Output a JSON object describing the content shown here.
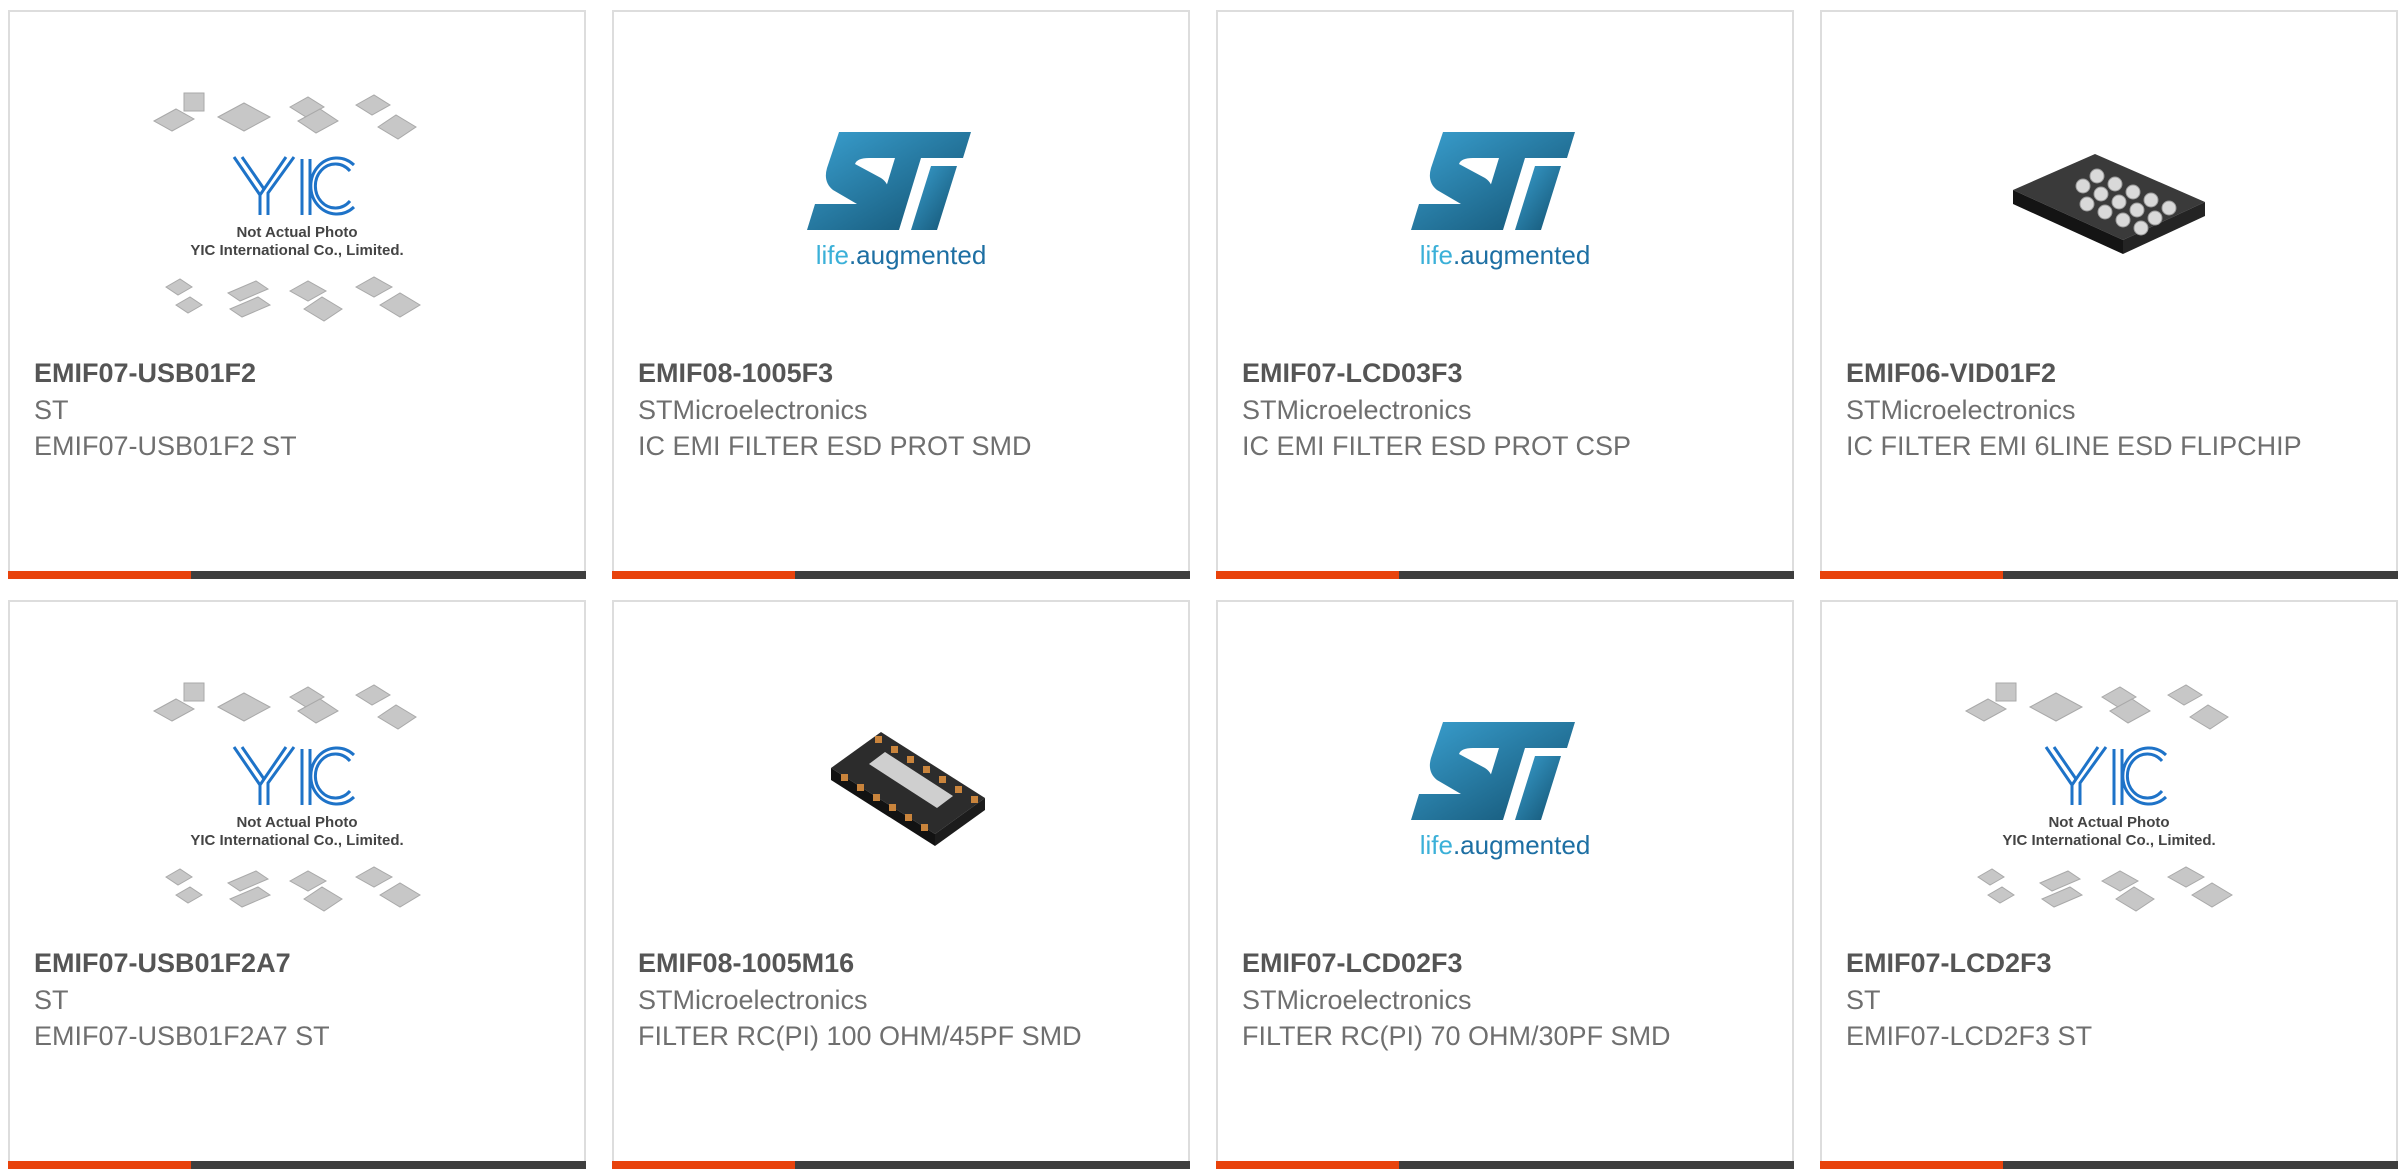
{
  "colors": {
    "accent": "#e8430c",
    "bar": "#3e3e3e",
    "st_blue": "#1d6fa3",
    "st_light": "#3bb0d8",
    "yic_blue": "#1e73c8"
  },
  "products": [
    {
      "part": "EMIF07-USB01F2",
      "maker": "ST",
      "desc": "EMIF07-USB01F2 ST",
      "image": "yic-placeholder-image",
      "caption1": "Not Actual Photo",
      "caption2": "YIC International Co., Limited."
    },
    {
      "part": "EMIF08-1005F3",
      "maker": "STMicroelectronics",
      "desc": "IC EMI FILTER ESD PROT SMD",
      "image": "st-logo-image",
      "tagline1": "life",
      "tagline2": ".augmented"
    },
    {
      "part": "EMIF07-LCD03F3",
      "maker": "STMicroelectronics",
      "desc": "IC EMI FILTER ESD PROT CSP",
      "image": "st-logo-image",
      "tagline1": "life",
      "tagline2": ".augmented"
    },
    {
      "part": "EMIF06-VID01F2",
      "maker": "STMicroelectronics",
      "desc": "IC FILTER EMI 6LINE ESD FLIPCHIP",
      "image": "bga-chip-image"
    },
    {
      "part": "EMIF07-USB01F2A7",
      "maker": "ST",
      "desc": "EMIF07-USB01F2A7 ST",
      "image": "yic-placeholder-image",
      "caption1": "Not Actual Photo",
      "caption2": "YIC International Co., Limited."
    },
    {
      "part": "EMIF08-1005M16",
      "maker": "STMicroelectronics",
      "desc": "FILTER RC(PI) 100 OHM/45PF SMD",
      "image": "qfn-chip-image"
    },
    {
      "part": "EMIF07-LCD02F3",
      "maker": "STMicroelectronics",
      "desc": "FILTER RC(PI) 70 OHM/30PF SMD",
      "image": "st-logo-image",
      "tagline1": "life",
      "tagline2": ".augmented"
    },
    {
      "part": "EMIF07-LCD2F3",
      "maker": "ST",
      "desc": "EMIF07-LCD2F3 ST",
      "image": "yic-placeholder-image",
      "caption1": "Not Actual Photo",
      "caption2": "YIC International Co., Limited."
    }
  ]
}
